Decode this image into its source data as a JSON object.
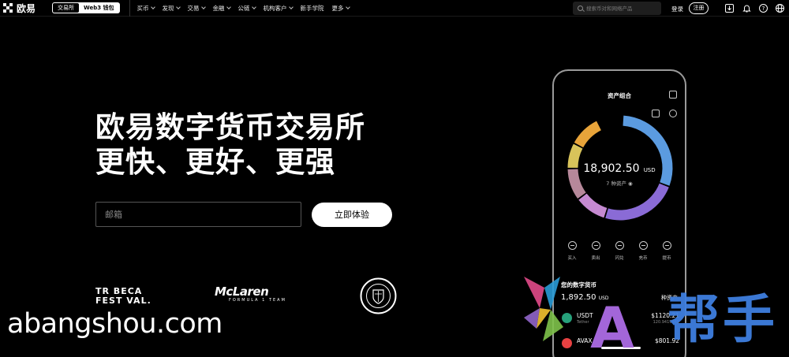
{
  "nav": {
    "logo_text": "欧易",
    "mode_tabs": [
      "交易所",
      "Web3 钱包"
    ],
    "menu": [
      {
        "label": "买币",
        "dropdown": true
      },
      {
        "label": "发现",
        "dropdown": true
      },
      {
        "label": "交易",
        "dropdown": true
      },
      {
        "label": "金融",
        "dropdown": true
      },
      {
        "label": "公链",
        "dropdown": true
      },
      {
        "label": "机构客户",
        "dropdown": true
      },
      {
        "label": "新手学院",
        "dropdown": false
      },
      {
        "label": "更多",
        "dropdown": true
      }
    ],
    "search_placeholder": "搜索币对和网络产品",
    "login": "登录",
    "register": "注册",
    "icons": [
      "download-icon",
      "bell-icon",
      "help-icon",
      "globe-icon"
    ]
  },
  "hero": {
    "headline_line1": "欧易数字货币交易所",
    "headline_line2": "更快、更好、更强",
    "email_placeholder": "邮箱",
    "cta_label": "立即体验"
  },
  "partners": {
    "tribeca_line1": "TR BECA",
    "tribeca_line2": "FEST VAL.",
    "mclaren_name": "McLaren",
    "mclaren_sub": "FORMULA 1 TEAM",
    "mancity_text": "MANCHESTER CITY"
  },
  "phone": {
    "title": "资产组合",
    "balance_amount": "18,902.50",
    "balance_currency": "USD",
    "asset_count": "7 种资产",
    "ring_segments": [
      {
        "color": "#5b9be0",
        "share": 0.3
      },
      {
        "color": "#8a6bd6",
        "share": 0.24
      },
      {
        "color": "#c58ad1",
        "share": 0.1
      },
      {
        "color": "#b6889a",
        "share": 0.1
      },
      {
        "color": "#d8c35a",
        "share": 0.08
      },
      {
        "color": "#e8a43a",
        "share": 0.1
      }
    ],
    "actions": [
      "买入",
      "卖出",
      "闪兑",
      "充币",
      "提币"
    ],
    "section_title": "您的数字货币",
    "section_amount": "1,892.50",
    "section_currency": "USD",
    "section_right": "种资产",
    "coins": [
      {
        "symbol": "USDT",
        "name": "Tether",
        "value": "$1120.21",
        "qty": "120.9419945",
        "color": "#26a17b"
      },
      {
        "symbol": "AVAX",
        "name": "",
        "value": "$801.92",
        "qty": "",
        "color": "#e84142"
      }
    ]
  },
  "watermark": {
    "site": "abangshou.com",
    "cn": "帮手",
    "letter": "A"
  }
}
